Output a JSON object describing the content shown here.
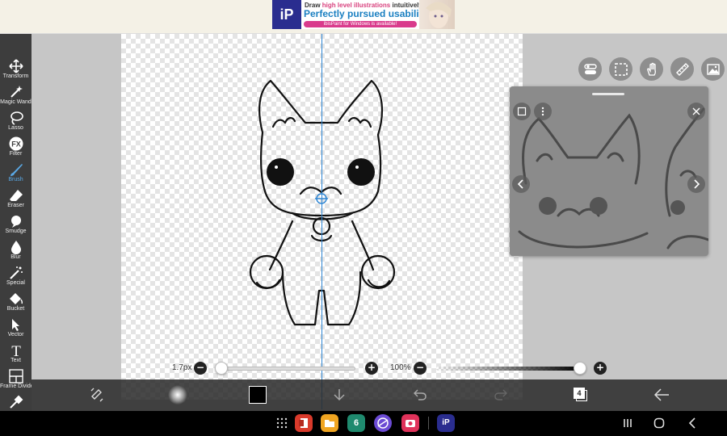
{
  "ad": {
    "logo": "iP",
    "line1_prefix": "Draw ",
    "line1_highlight": "high level illustrations",
    "line1_suffix": " intuitively!",
    "line2": "Perfectly pursued usability!",
    "pill": "ibisPaint for Windows is available!"
  },
  "tools": [
    {
      "label": "Transform",
      "icon": "transform-icon"
    },
    {
      "label": "Magic Wand",
      "icon": "magic-wand-icon"
    },
    {
      "label": "Lasso",
      "icon": "lasso-icon"
    },
    {
      "label": "Filter",
      "icon": "fx-icon",
      "glyph": "FX"
    },
    {
      "label": "Brush",
      "icon": "brush-icon",
      "active": true
    },
    {
      "label": "Eraser",
      "icon": "eraser-icon"
    },
    {
      "label": "Smudge",
      "icon": "smudge-icon"
    },
    {
      "label": "Blur",
      "icon": "blur-icon"
    },
    {
      "label": "Special",
      "icon": "special-icon"
    },
    {
      "label": "Bucket",
      "icon": "bucket-icon"
    },
    {
      "label": "Vector",
      "icon": "vector-icon"
    },
    {
      "label": "Text",
      "icon": "text-icon",
      "glyph": "T"
    },
    {
      "label": "Frame Divider",
      "icon": "frame-divider-icon"
    },
    {
      "label": "",
      "icon": "eyedropper-icon"
    }
  ],
  "quick_buttons": [
    "toggle-icon",
    "selection-icon",
    "hand-icon",
    "ruler-icon",
    "image-icon"
  ],
  "sliders": {
    "size_label": "1.7px",
    "size_value_fraction": 0.0,
    "opacity_label": "100%",
    "opacity_value_fraction": 1.0,
    "minus": "−",
    "plus": "+"
  },
  "bottom": {
    "layers_count": "4"
  },
  "colors": {
    "accent": "#2e86d4",
    "toolbar": "#3d3d3d",
    "primary_color_swatch": "#000000"
  },
  "dock_apps": [
    {
      "icon": "office-app-icon",
      "color": "#d93a2b"
    },
    {
      "icon": "files-app-icon",
      "color": "#f0a521"
    },
    {
      "icon": "calendar-app-icon",
      "color": "#1f8a6e",
      "glyph": "6"
    },
    {
      "icon": "internet-app-icon",
      "color": "#6c4bd4"
    },
    {
      "icon": "camera-app-icon",
      "color": "#e0325a"
    },
    {
      "icon": "ibispaint-app-icon",
      "color": "#2a2d8f",
      "glyph": "iP"
    }
  ]
}
